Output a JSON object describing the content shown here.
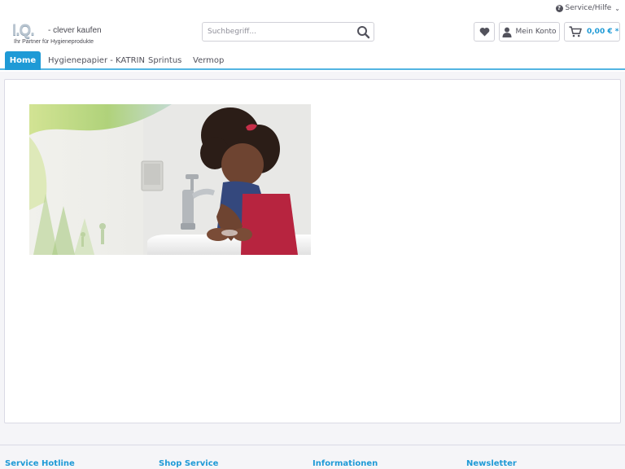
{
  "header": {
    "service_label": "Service/Hilfe",
    "logo": {
      "mark": "I.Q.",
      "claim": "- clever kaufen",
      "subline": "Ihr Partner für Hygieneprodukte"
    },
    "search": {
      "placeholder": "Suchbegriff..."
    },
    "account_label": "Mein Konto",
    "cart_amount": "0,00 € *"
  },
  "nav": {
    "items": [
      {
        "label": "Home",
        "active": true
      },
      {
        "label": "Hygienepapier - KATRIN"
      },
      {
        "label": "Sprintus"
      },
      {
        "label": "Vermop"
      }
    ]
  },
  "footer": {
    "columns": [
      {
        "title": "Service Hotline"
      },
      {
        "title": "Shop Service"
      },
      {
        "title": "Informationen"
      },
      {
        "title": "Newsletter"
      }
    ]
  },
  "colors": {
    "accent": "#1e9ad6",
    "text": "#52525c",
    "border": "#dadae5"
  }
}
